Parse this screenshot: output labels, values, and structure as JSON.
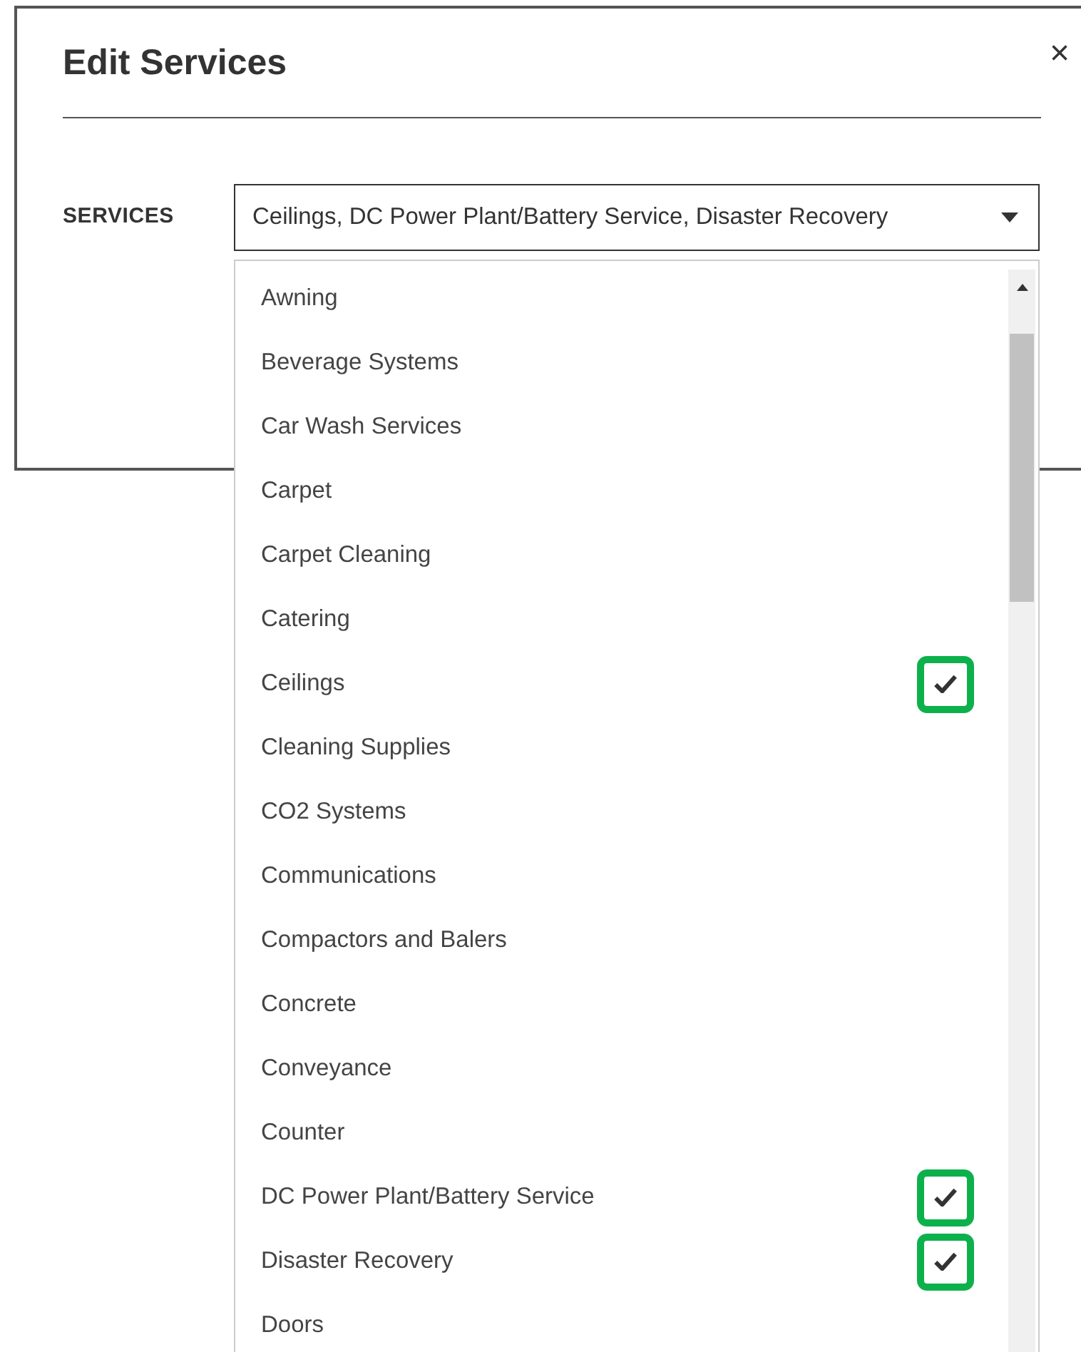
{
  "dialog": {
    "title": "Edit Services",
    "close": "×"
  },
  "field": {
    "label": "SERVICES",
    "value": "Ceilings, DC Power Plant/Battery Service, Disaster Recovery",
    "expanded": true
  },
  "options": [
    {
      "label": "Awning",
      "checked": false
    },
    {
      "label": "Beverage Systems",
      "checked": false
    },
    {
      "label": "Car Wash Services",
      "checked": false
    },
    {
      "label": "Carpet",
      "checked": false
    },
    {
      "label": "Carpet Cleaning",
      "checked": false
    },
    {
      "label": "Catering",
      "checked": false
    },
    {
      "label": "Ceilings",
      "checked": true
    },
    {
      "label": "Cleaning Supplies",
      "checked": false
    },
    {
      "label": "CO2 Systems",
      "checked": false
    },
    {
      "label": "Communications",
      "checked": false
    },
    {
      "label": "Compactors and Balers",
      "checked": false
    },
    {
      "label": "Concrete",
      "checked": false
    },
    {
      "label": "Conveyance",
      "checked": false
    },
    {
      "label": "Counter",
      "checked": false
    },
    {
      "label": "DC Power Plant/Battery Service",
      "checked": true
    },
    {
      "label": "Disaster Recovery",
      "checked": true
    },
    {
      "label": "Doors",
      "checked": false
    }
  ]
}
